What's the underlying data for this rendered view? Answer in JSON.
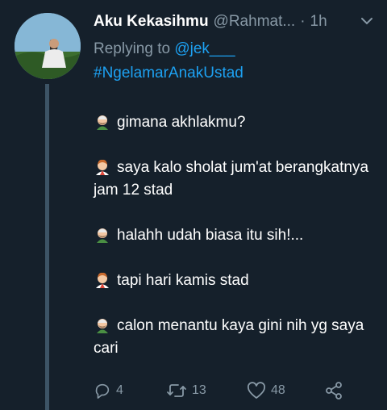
{
  "tweet": {
    "author_name": "Aku Kekasihmu",
    "author_handle": "@Rahmat...",
    "separator": "·",
    "time": "1h",
    "replying_prefix": "Replying to",
    "replying_to": "@jek___",
    "hashtag": "#NgelamarAnakUstad",
    "lines": [
      {
        "speaker": "father-emoji",
        "text": "gimana akhlakmu?"
      },
      {
        "speaker": "boy-emoji",
        "text": "saya kalo sholat jum'at berangkatnya jam 12 stad"
      },
      {
        "speaker": "father-emoji",
        "text": "halahh udah biasa itu sih!..."
      },
      {
        "speaker": "boy-emoji",
        "text": "tapi hari kamis stad"
      },
      {
        "speaker": "father-emoji",
        "text": "calon menantu kaya gini nih yg saya cari"
      }
    ]
  },
  "actions": {
    "reply_count": "4",
    "retweet_count": "13",
    "like_count": "48"
  },
  "colors": {
    "background": "#15202b",
    "secondary_text": "#8899a6",
    "link": "#1da1f2",
    "thread_line": "#3d5466"
  }
}
